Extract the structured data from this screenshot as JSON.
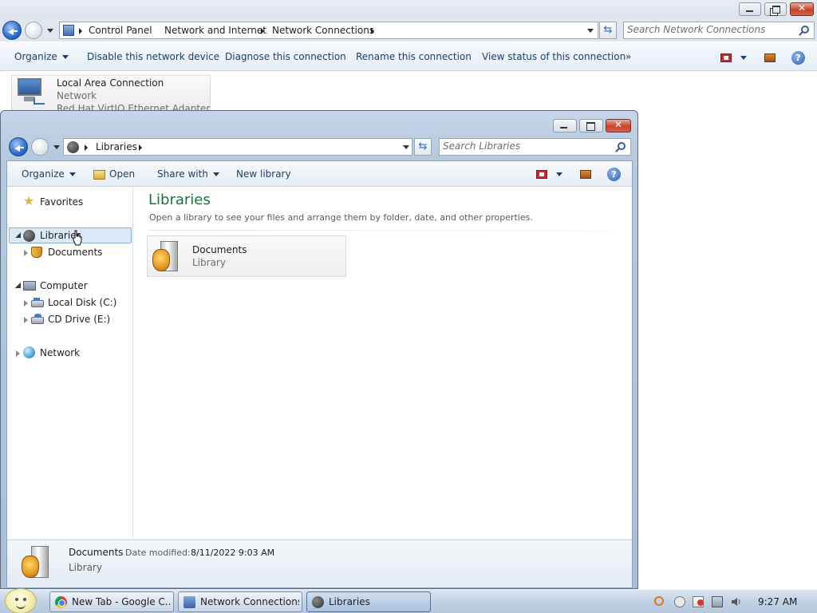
{
  "bg_window": {
    "breadcrumbs": [
      "Control Panel",
      "Network and Internet",
      "Network Connections"
    ],
    "search_placeholder": "Search Network Connections",
    "commands": {
      "organize": "Organize",
      "disable": "Disable this network device",
      "diagnose": "Diagnose this connection",
      "rename": "Rename this connection",
      "view_status": "View status of this connection",
      "more": "»"
    },
    "connection": {
      "name": "Local Area Connection",
      "status": "Network",
      "adapter": "Red Hat VirtIO Ethernet Adapter"
    }
  },
  "lib_window": {
    "breadcrumb": "Libraries",
    "search_placeholder": "Search Libraries",
    "commands": {
      "organize": "Organize",
      "open": "Open",
      "share_with": "Share with",
      "new_library": "New library"
    },
    "nav": {
      "favorites": "Favorites",
      "libraries": "Libraries",
      "documents": "Documents",
      "computer": "Computer",
      "local_disk": "Local Disk (C:)",
      "cd_drive": "CD Drive (E:)",
      "network": "Network"
    },
    "content": {
      "heading": "Libraries",
      "description": "Open a library to see your files and arrange them by folder, date, and other properties.",
      "tile": {
        "name": "Documents",
        "type": "Library"
      }
    },
    "details": {
      "name": "Documents",
      "modified_label": "Date modified:",
      "modified_value": "8/11/2022 9:03 AM",
      "type": "Library"
    }
  },
  "taskbar": {
    "items": [
      {
        "label": "New Tab - Google C...",
        "icon": "chrome-icon"
      },
      {
        "label": "Network Connections",
        "icon": "network-connections-icon"
      },
      {
        "label": "Libraries",
        "icon": "libraries-icon",
        "active": true
      }
    ],
    "clock": "9:27 AM"
  },
  "colors": {
    "heading_green": "#1e6e3e",
    "selection": "#dbeaf9",
    "close_red": "#c8432c"
  }
}
